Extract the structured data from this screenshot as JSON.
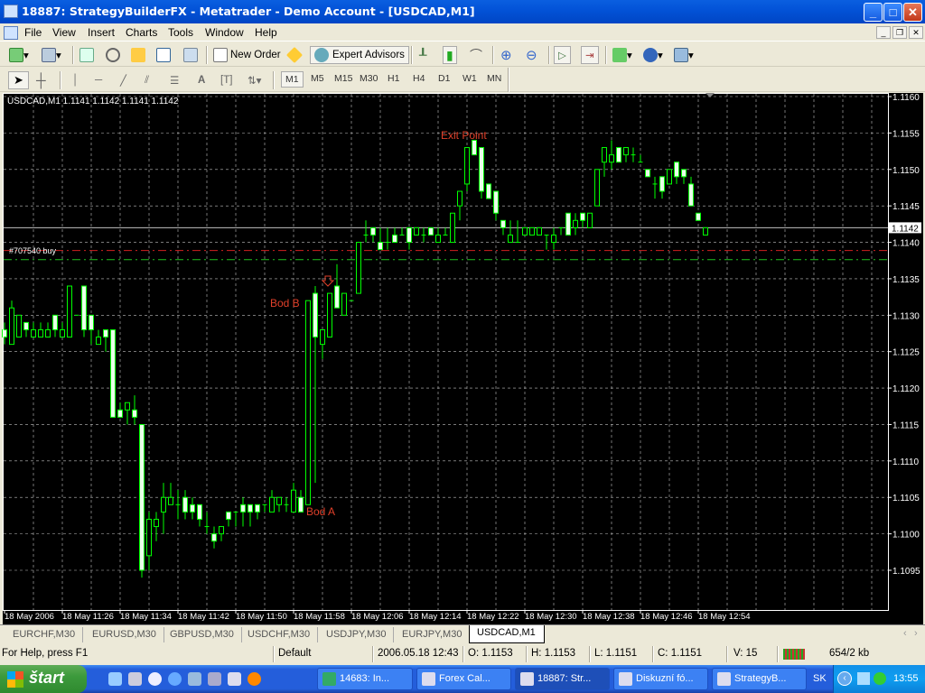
{
  "window": {
    "title": "18887: StrategyBuilderFX - Metatrader - Demo Account - [USDCAD,M1]",
    "minimize": "_",
    "maximize": "□",
    "close": "✕"
  },
  "menu": [
    "File",
    "View",
    "Insert",
    "Charts",
    "Tools",
    "Window",
    "Help"
  ],
  "mdi": [
    "_",
    "❐",
    "✕"
  ],
  "toolbar": {
    "new_order": "New Order",
    "expert_advisors": "Expert Advisors"
  },
  "timeframes": [
    "M1",
    "M5",
    "M15",
    "M30",
    "H1",
    "H4",
    "D1",
    "W1",
    "MN"
  ],
  "active_timeframe": "M1",
  "chart": {
    "info": "USDCAD,M1  1.1141 1.1142 1.1141 1.1142",
    "order_label": "#707540 buy",
    "current_price": "1.1142",
    "annotations": {
      "bod_a": "Bod A",
      "bod_b": "Bod B",
      "exit_point": "Exit Point"
    },
    "price_labels": [
      "1.1160",
      "1.1155",
      "1.1150",
      "1.1145",
      "1.1140",
      "1.1135",
      "1.1130",
      "1.1125",
      "1.1120",
      "1.1115",
      "1.1110",
      "1.1105",
      "1.1100",
      "1.1095"
    ],
    "time_labels": [
      "18 May 2006",
      "18 May 11:26",
      "18 May 11:34",
      "18 May 11:42",
      "18 May 11:50",
      "18 May 11:58",
      "18 May 12:06",
      "18 May 12:14",
      "18 May 12:22",
      "18 May 12:30",
      "18 May 12:38",
      "18 May 12:46",
      "18 May 12:54"
    ]
  },
  "chart_data": {
    "type": "candlestick",
    "symbol": "USDCAD",
    "timeframe": "M1",
    "ylim": [
      1.1091,
      1.11605
    ],
    "current_price": 1.1142,
    "order_line": 1.1139,
    "order_stop_line": 1.1138,
    "ohlc": [
      [
        1.1128,
        1.1129,
        1.1126,
        1.1127
      ],
      [
        1.1126,
        1.1132,
        1.1126,
        1.1131
      ],
      [
        1.1127,
        1.113,
        1.1127,
        1.113
      ],
      [
        1.1129,
        1.1129,
        1.1127,
        1.1128
      ],
      [
        1.1127,
        1.1129,
        1.1127,
        1.1128
      ],
      [
        1.1127,
        1.1129,
        1.1127,
        1.1128
      ],
      [
        1.1127,
        1.1129,
        1.1127,
        1.1128
      ],
      [
        1.113,
        1.113,
        1.1127,
        1.1128
      ],
      [
        1.1127,
        1.1129,
        1.1127,
        1.1128
      ],
      [
        1.1127,
        1.1134,
        1.1127,
        1.1134
      ],
      [
        1.113,
        1.113,
        1.113,
        1.113
      ],
      [
        1.1134,
        1.1134,
        1.1127,
        1.1128
      ],
      [
        1.113,
        1.113,
        1.1126,
        1.1128
      ],
      [
        1.1126,
        1.1128,
        1.1126,
        1.1127
      ],
      [
        1.1128,
        1.1128,
        1.1125,
        1.1127
      ],
      [
        1.1128,
        1.1128,
        1.1116,
        1.1116
      ],
      [
        1.1117,
        1.1118,
        1.1116,
        1.1116
      ],
      [
        1.1117,
        1.1118,
        1.1115,
        1.1118
      ],
      [
        1.1117,
        1.1119,
        1.1115,
        1.1116
      ],
      [
        1.1115,
        1.1115,
        1.1094,
        1.1095
      ],
      [
        1.1097,
        1.1103,
        1.1095,
        1.1102
      ],
      [
        1.1101,
        1.1103,
        1.1099,
        1.1102
      ],
      [
        1.1103,
        1.1107,
        1.11,
        1.1105
      ],
      [
        1.1104,
        1.1107,
        1.1104,
        1.1105
      ],
      [
        1.1104,
        1.1106,
        1.1102,
        1.1104
      ],
      [
        1.1105,
        1.1106,
        1.1102,
        1.1103
      ],
      [
        1.1104,
        1.1105,
        1.1102,
        1.1103
      ],
      [
        1.1104,
        1.1104,
        1.1101,
        1.1102
      ],
      [
        1.1101,
        1.1103,
        1.11,
        1.1101
      ],
      [
        1.11,
        1.1101,
        1.1098,
        1.1099
      ],
      [
        1.11,
        1.1101,
        1.1099,
        1.1101
      ],
      [
        1.1103,
        1.1103,
        1.1101,
        1.1102
      ],
      [
        1.1103,
        1.1103,
        1.1101,
        1.1103
      ],
      [
        1.1104,
        1.1105,
        1.1101,
        1.1103
      ],
      [
        1.1104,
        1.1104,
        1.1101,
        1.1103
      ],
      [
        1.1104,
        1.1104,
        1.1102,
        1.1103
      ],
      [
        1.1104,
        1.1104,
        1.1103,
        1.1104
      ],
      [
        1.1103,
        1.1106,
        1.1103,
        1.1105
      ],
      [
        1.1104,
        1.1105,
        1.1103,
        1.1105
      ],
      [
        1.1104,
        1.1105,
        1.1103,
        1.1104
      ],
      [
        1.1103,
        1.1107,
        1.1103,
        1.1106
      ],
      [
        1.1105,
        1.1106,
        1.1103,
        1.1103
      ],
      [
        1.1104,
        1.1132,
        1.1104,
        1.1132
      ],
      [
        1.1133,
        1.1134,
        1.1107,
        1.1127
      ],
      [
        1.1126,
        1.1128,
        1.1124,
        1.1128
      ],
      [
        1.1127,
        1.1133,
        1.1127,
        1.1133
      ],
      [
        1.1134,
        1.1137,
        1.1131,
        1.1131
      ],
      [
        1.113,
        1.1133,
        1.113,
        1.1133
      ],
      [
        1.1132,
        1.1132,
        1.1132,
        1.1132
      ],
      [
        1.1133,
        1.114,
        1.1133,
        1.114
      ],
      [
        1.1141,
        1.1143,
        1.114,
        1.1141
      ],
      [
        1.1142,
        1.1142,
        1.114,
        1.1141
      ],
      [
        1.114,
        1.1142,
        1.1139,
        1.1139
      ],
      [
        1.114,
        1.1142,
        1.1139,
        1.114
      ],
      [
        1.1141,
        1.1142,
        1.114,
        1.114
      ],
      [
        1.1141,
        1.1142,
        1.1141,
        1.1141
      ],
      [
        1.1142,
        1.1142,
        1.1139,
        1.114
      ],
      [
        1.1141,
        1.1142,
        1.1141,
        1.1142
      ],
      [
        1.1141,
        1.1142,
        1.114,
        1.1141
      ],
      [
        1.1142,
        1.1142,
        1.1141,
        1.1141
      ],
      [
        1.114,
        1.1142,
        1.114,
        1.1141
      ],
      [
        1.1141,
        1.1142,
        1.1141,
        1.1141
      ],
      [
        1.114,
        1.1144,
        1.114,
        1.1144
      ],
      [
        1.1145,
        1.1147,
        1.1143,
        1.1147
      ],
      [
        1.1148,
        1.1153,
        1.1147,
        1.1153
      ],
      [
        1.1154,
        1.1154,
        1.1152,
        1.1152
      ],
      [
        1.1153,
        1.1153,
        1.1146,
        1.1147
      ],
      [
        1.1148,
        1.1148,
        1.1146,
        1.1146
      ],
      [
        1.1147,
        1.1147,
        1.1143,
        1.1144
      ],
      [
        1.1143,
        1.1143,
        1.1141,
        1.1142
      ],
      [
        1.114,
        1.1143,
        1.114,
        1.1141
      ],
      [
        1.114,
        1.1143,
        1.114,
        1.114
      ],
      [
        1.1141,
        1.1142,
        1.1141,
        1.1142
      ],
      [
        1.1141,
        1.1142,
        1.1141,
        1.1142
      ],
      [
        1.1141,
        1.1142,
        1.1141,
        1.1142
      ],
      [
        1.1141,
        1.1141,
        1.1139,
        1.1141
      ],
      [
        1.114,
        1.1142,
        1.1139,
        1.1141
      ],
      [
        1.1142,
        1.1142,
        1.1141,
        1.1142
      ],
      [
        1.1144,
        1.1144,
        1.1141,
        1.1141
      ],
      [
        1.1142,
        1.1144,
        1.1141,
        1.1143
      ],
      [
        1.1144,
        1.1144,
        1.1142,
        1.1143
      ],
      [
        1.1142,
        1.1144,
        1.1142,
        1.1144
      ],
      [
        1.1145,
        1.115,
        1.1145,
        1.115
      ],
      [
        1.1151,
        1.1153,
        1.1149,
        1.1153
      ],
      [
        1.1151,
        1.1154,
        1.115,
        1.1152
      ],
      [
        1.1153,
        1.1153,
        1.1151,
        1.1151
      ],
      [
        1.1152,
        1.1153,
        1.1151,
        1.1153
      ],
      [
        1.1152,
        1.1153,
        1.1151,
        1.1152
      ],
      [
        1.1151,
        1.1152,
        1.1151,
        1.1151
      ],
      [
        1.115,
        1.115,
        1.1149,
        1.1149
      ],
      [
        1.1148,
        1.1149,
        1.1146,
        1.1148
      ],
      [
        1.1149,
        1.1149,
        1.1146,
        1.1147
      ],
      [
        1.1148,
        1.115,
        1.1148,
        1.115
      ],
      [
        1.1151,
        1.1151,
        1.1148,
        1.1149
      ],
      [
        1.115,
        1.115,
        1.1148,
        1.1149
      ],
      [
        1.1148,
        1.1149,
        1.1145,
        1.1145
      ],
      [
        1.1144,
        1.1144,
        1.1143,
        1.1143
      ],
      [
        1.1141,
        1.1142,
        1.1141,
        1.1142
      ]
    ],
    "annotations": [
      {
        "text": "Bod A",
        "candle": 42,
        "price": 1.1104
      },
      {
        "text": "Bod B",
        "candle": 42,
        "price": 1.1132
      },
      {
        "text": "Exit Point",
        "candle": 65,
        "price": 1.1154
      }
    ],
    "colors": {
      "bull": "#00ff00",
      "bear_fill": "#eaffea",
      "grid": "#c0c0c0",
      "label": "#e0402a",
      "order": "#d02020",
      "stop": "#20c020"
    }
  },
  "tabs": [
    "EURCHF,M30",
    "EURUSD,M30",
    "GBPUSD,M30",
    "USDCHF,M30",
    "USDJPY,M30",
    "EURJPY,M30",
    "USDCAD,M1"
  ],
  "status": {
    "help": "For Help, press F1",
    "profile": "Default",
    "datetime": "2006.05.18 12:43",
    "open": "O: 1.1153",
    "high": "H: 1.1153",
    "low": "L: 1.1151",
    "close": "C: 1.1151",
    "volume": "V: 15",
    "traffic": "654/2 kb"
  },
  "taskbar": {
    "start": "štart",
    "tasks": [
      "14683: In...",
      "Forex Cal...",
      "18887: Str...",
      "Diskuzní fó...",
      "StrategyB..."
    ],
    "language": "SK",
    "clock": "13:55"
  }
}
